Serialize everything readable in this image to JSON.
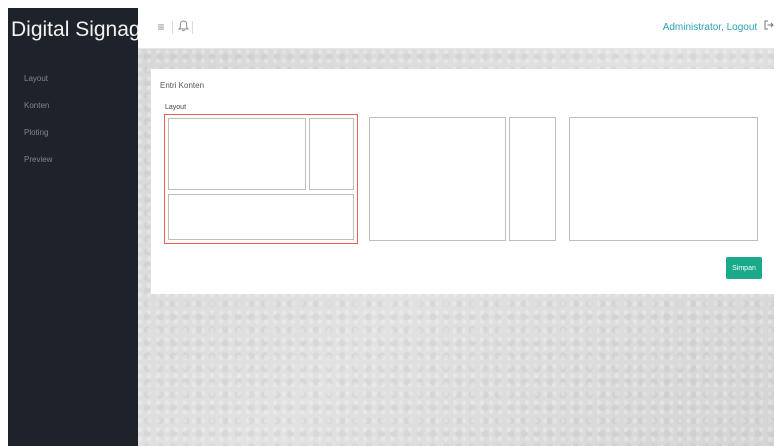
{
  "brand": {
    "title": "Digital Signage"
  },
  "sidebar": {
    "items": [
      {
        "label": "Layout"
      },
      {
        "label": "Konten"
      },
      {
        "label": "Ploting"
      },
      {
        "label": "Preview"
      }
    ]
  },
  "topbar": {
    "user_name": "Administrator,",
    "logout_label": "Logout",
    "menu_icon": "hamburger-menu-icon",
    "notification_icon": "bell-icon",
    "logout_icon": "logout-icon"
  },
  "main": {
    "panel_title": "Entri Konten",
    "layout_label": "Layout",
    "selected_layout": 1,
    "save_label": "Simpan"
  },
  "colors": {
    "sidebar_bg": "#1e222a",
    "accent_link": "#29a3b8",
    "save_button": "#1aa98a",
    "selected_outline": "#e8605c"
  }
}
